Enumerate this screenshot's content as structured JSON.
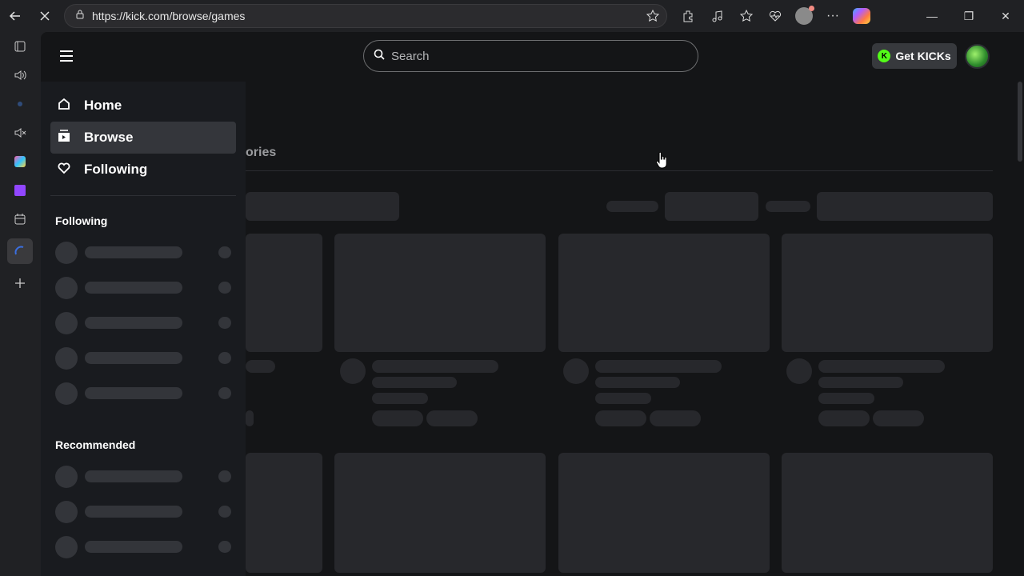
{
  "browser": {
    "url": "https://kick.com/browse/games",
    "icons": [
      "back-icon",
      "reload-icon",
      "lock-icon",
      "star-icon",
      "extensions-icon",
      "media-icon",
      "favorites-icon",
      "health-icon",
      "profile-icon",
      "more-icon",
      "copilot-icon"
    ]
  },
  "window": {
    "minimize": "—",
    "restore": "❐",
    "close": "✕"
  },
  "header": {
    "search_placeholder": "Search",
    "get_kicks_label": "Get KICKs",
    "kicks_coin": "K"
  },
  "main": {
    "categories_title_visible": "ories"
  },
  "sidebar": {
    "nav": [
      {
        "label": "Home",
        "icon": "home-icon"
      },
      {
        "label": "Browse",
        "icon": "browse-icon",
        "active": true
      },
      {
        "label": "Following",
        "icon": "heart-icon"
      }
    ],
    "following_title": "Following",
    "recommended_title": "Recommended"
  },
  "colors": {
    "accent": "#53fc18",
    "page_bg": "#141517",
    "drawer_bg": "#191b1f",
    "skeleton": "#27282c"
  }
}
